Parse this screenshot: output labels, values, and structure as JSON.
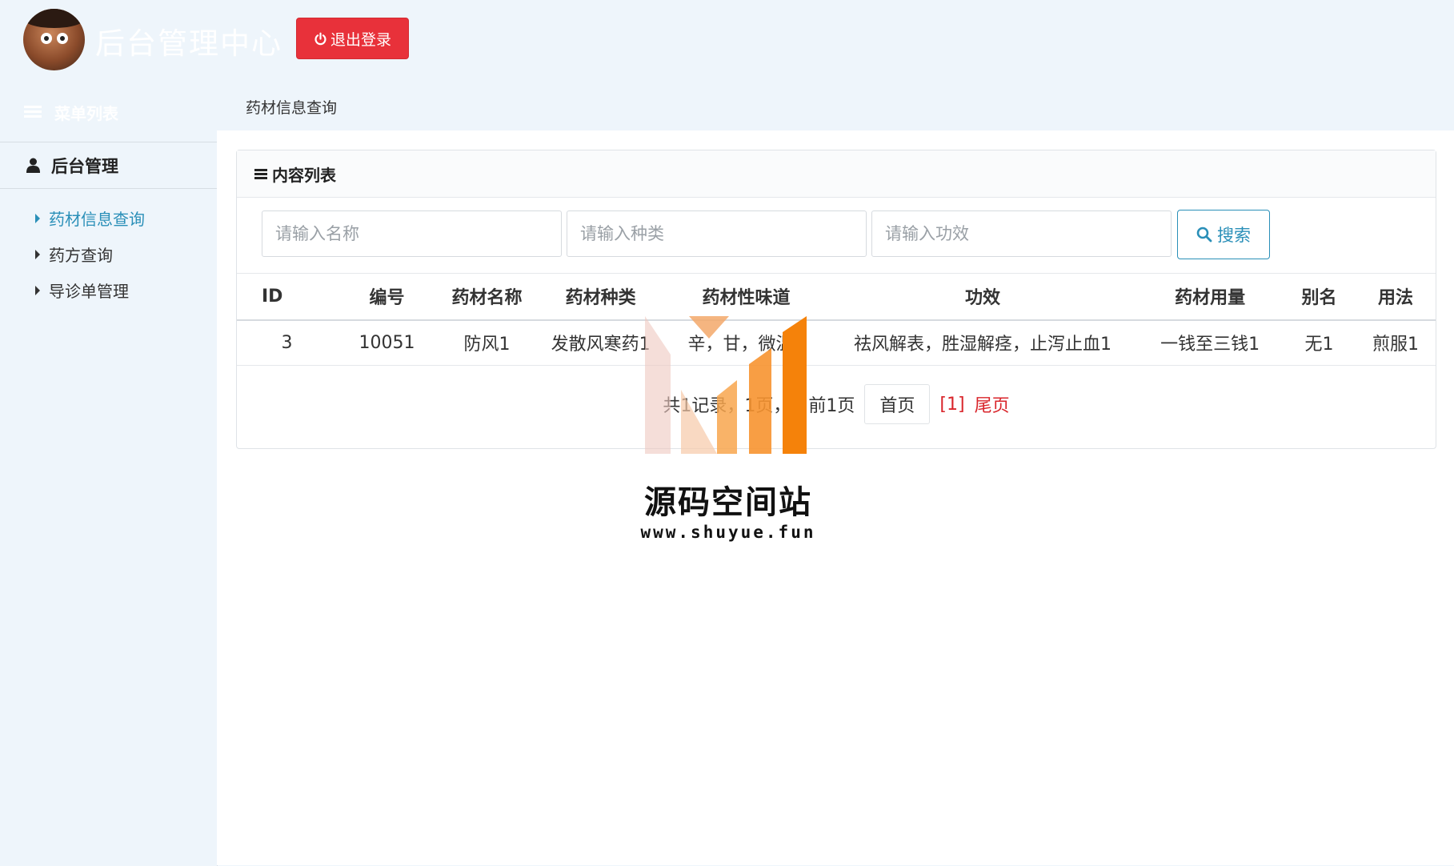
{
  "header": {
    "app_title": "后台管理中心",
    "logout_label": "退出登录"
  },
  "menu_header": "菜单列表",
  "breadcrumb_tab": "药材信息查询",
  "sidebar": {
    "group_label": "后台管理",
    "items": [
      {
        "label": "药材信息查询",
        "active": true
      },
      {
        "label": "药方查询",
        "active": false
      },
      {
        "label": "导诊单管理",
        "active": false
      }
    ]
  },
  "panel": {
    "title": "内容列表",
    "search": {
      "name_placeholder": "请输入名称",
      "type_placeholder": "请输入种类",
      "effect_placeholder": "请输入功效",
      "button_label": "搜索"
    },
    "table": {
      "columns": [
        "ID",
        "编号",
        "药材名称",
        "药材种类",
        "药材性味道",
        "功效",
        "药材用量",
        "别名",
        "用法"
      ],
      "rows": [
        [
          "3",
          "10051",
          "防风1",
          "发散风寒药1",
          "辛，甘，微温1",
          "祛风解表，胜湿解痉，止泻止血1",
          "一钱至三钱1",
          "无1",
          "煎服1"
        ]
      ]
    },
    "pager": {
      "summary": "共1记录，1页，当前1页",
      "first_label": "首页",
      "current_label": "[1]",
      "last_label": "尾页"
    }
  },
  "watermark": {
    "title": "源码空间站",
    "url": "www.shuyue.fun"
  },
  "colors": {
    "background": "#eef5fb",
    "logout": "#e8313a",
    "accent": "#2a8fb8",
    "pager_red": "#d9252b"
  }
}
